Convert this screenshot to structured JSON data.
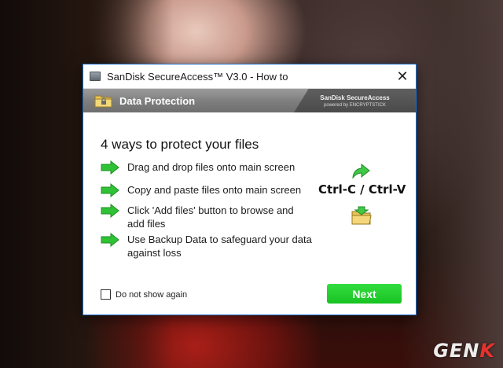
{
  "window": {
    "title": "SanDisk SecureAccess™ V3.0 - How to",
    "close_glyph": "✕"
  },
  "header": {
    "title": "Data Protection",
    "brand_name": "SanDisk SecureAccess",
    "brand_sub": "powered by ENCRYPTSTICK"
  },
  "main": {
    "heading": "4 ways to protect your files",
    "items": [
      {
        "label": "Drag and drop files onto main screen",
        "icon": "green-arrow-icon"
      },
      {
        "label": "Copy and paste files onto main screen",
        "icon": "green-arrow-icon"
      },
      {
        "label": "Click 'Add files' button to browse and add files",
        "icon": "green-arrow-icon"
      },
      {
        "label": "Use Backup Data to safeguard your data against loss",
        "icon": "green-arrow-icon"
      }
    ],
    "shortcut": "Ctrl-C / Ctrl-V"
  },
  "footer": {
    "checkbox_label": "Do not show again",
    "checkbox_checked": false,
    "next_label": "Next"
  },
  "watermark": {
    "part1": "GEN",
    "part2": "K"
  },
  "colors": {
    "accent_green": "#17c322",
    "titlebar_border": "#1a6fc9",
    "header_gray": "#7d7d7d"
  }
}
